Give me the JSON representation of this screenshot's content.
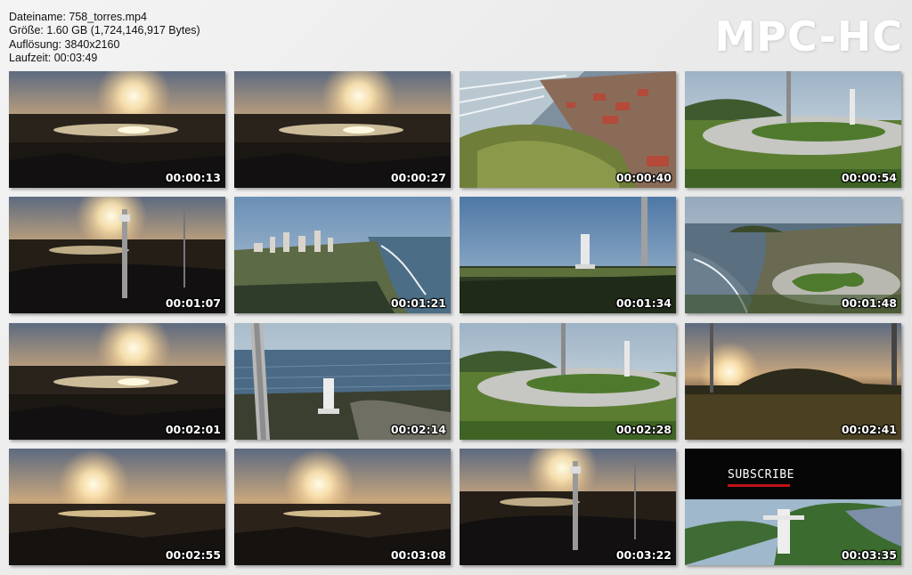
{
  "info": {
    "filename": "Dateiname: 758_torres.mp4",
    "size": "Größe: 1.60 GB (1,724,146,917 Bytes)",
    "resolution": "Auflösung: 3840x2160",
    "duration": "Laufzeit: 00:03:49"
  },
  "logo": "MPC-HC",
  "thumbnails": [
    {
      "time": "00:00:13",
      "scene": "sunset-lake"
    },
    {
      "time": "00:00:27",
      "scene": "sunset-lake"
    },
    {
      "time": "00:00:40",
      "scene": "coast-town"
    },
    {
      "time": "00:00:54",
      "scene": "plaza-day"
    },
    {
      "time": "00:01:07",
      "scene": "sunset-tower"
    },
    {
      "time": "00:01:21",
      "scene": "city-coast"
    },
    {
      "time": "00:01:34",
      "scene": "monument-tower"
    },
    {
      "time": "00:01:48",
      "scene": "coast-aerial"
    },
    {
      "time": "00:02:01",
      "scene": "sunset-lake"
    },
    {
      "time": "00:02:14",
      "scene": "tower-sea"
    },
    {
      "time": "00:02:28",
      "scene": "plaza-day"
    },
    {
      "time": "00:02:41",
      "scene": "sunset-hill"
    },
    {
      "time": "00:02:55",
      "scene": "sunset-wide"
    },
    {
      "time": "00:03:08",
      "scene": "sunset-wide"
    },
    {
      "time": "00:03:22",
      "scene": "sunset-tower"
    },
    {
      "time": "00:03:35",
      "scene": "subscribe"
    }
  ],
  "subscribe": {
    "title": "SUBSCRIBE"
  }
}
